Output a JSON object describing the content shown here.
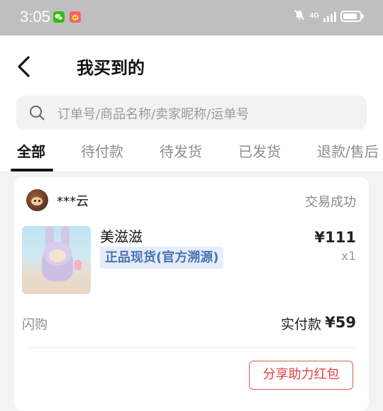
{
  "status_bar": {
    "time": "3:05",
    "network": "4G",
    "icons": [
      "wechat-icon",
      "notification-app-icon",
      "mute-icon",
      "signal-icon",
      "battery-icon"
    ],
    "battery_level": 0.85
  },
  "header": {
    "title": "我买到的",
    "back_icon": "chevron-left-icon"
  },
  "search": {
    "placeholder": "订单号/商品名称/卖家昵称/运单号",
    "icon": "search-icon"
  },
  "tabs": [
    {
      "label": "全部",
      "active": true
    },
    {
      "label": "待付款",
      "active": false
    },
    {
      "label": "待发货",
      "active": false
    },
    {
      "label": "已发货",
      "active": false
    },
    {
      "label": "退款/售后",
      "active": false
    }
  ],
  "order": {
    "seller_name": "***云",
    "status": "交易成功",
    "product": {
      "name": "美滋滋",
      "badge": "正品现货(官方溯源)",
      "price": "¥111",
      "quantity": "x1"
    },
    "tag": "闪购",
    "paid_label": "实付款",
    "paid_amount": "¥59",
    "action_button": "分享助力红包"
  },
  "colors": {
    "status_bar_bg": "#bfbfbf",
    "badge_bg": "#e7edf8",
    "badge_text": "#4873b7",
    "action_red": "#e0403f"
  }
}
